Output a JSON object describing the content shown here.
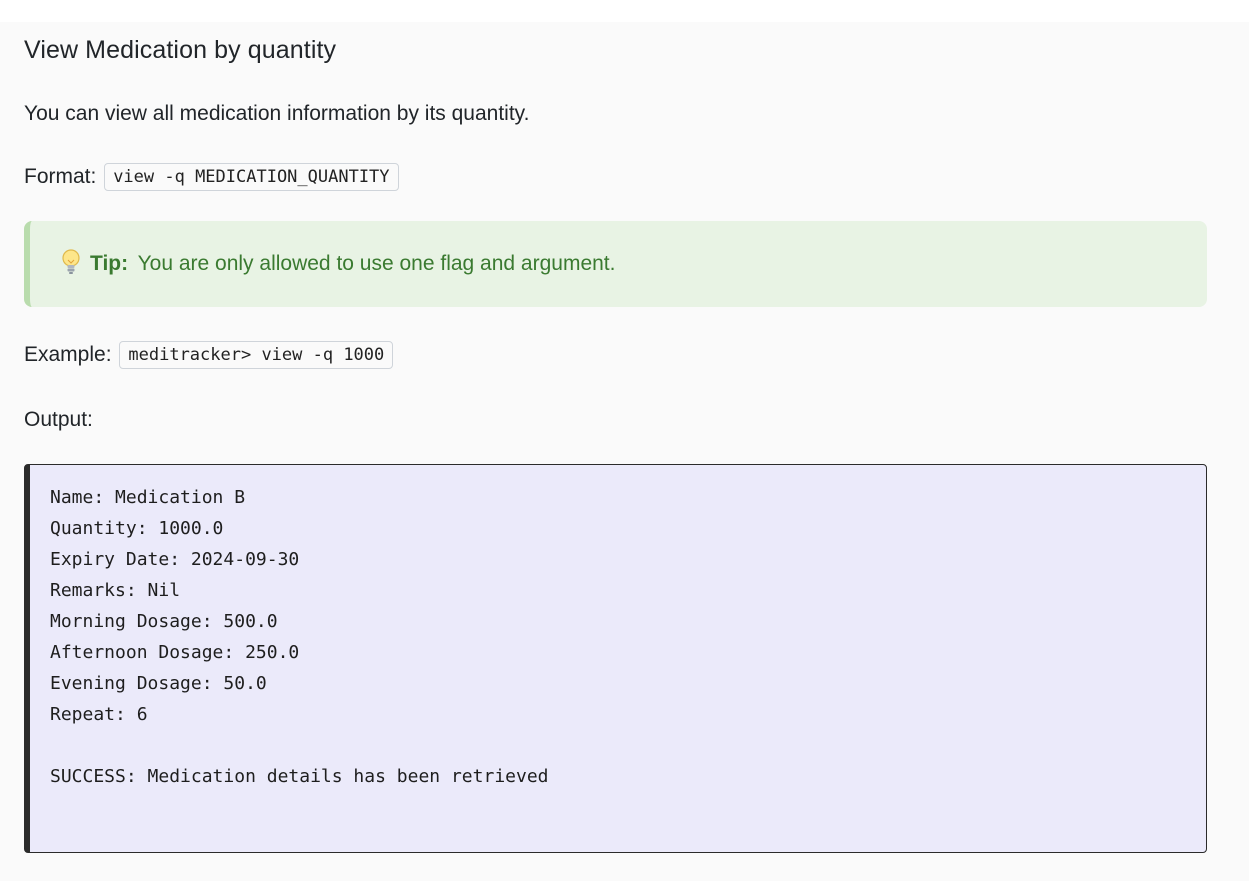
{
  "section": {
    "title": "View Medication by quantity",
    "description": "You can view all medication information by its quantity."
  },
  "format": {
    "label": "Format:",
    "command": "view -q MEDICATION_QUANTITY"
  },
  "tip": {
    "icon": "lightbulb-icon",
    "label": "Tip:",
    "text": "You are only allowed to use one flag and argument."
  },
  "example": {
    "label": "Example:",
    "command": "meditracker> view -q 1000"
  },
  "output": {
    "label": "Output:",
    "lines": [
      "Name: Medication B",
      "Quantity: 1000.0",
      "Expiry Date: 2024-09-30",
      "Remarks: Nil",
      "Morning Dosage: 500.0",
      "Afternoon Dosage: 250.0",
      "Evening Dosage: 50.0",
      "Repeat: 6",
      "",
      "SUCCESS: Medication details has been retrieved"
    ]
  },
  "colors": {
    "page_background": "#fafafa",
    "tip_background": "#e8f3e4",
    "tip_border": "#b9dcad",
    "tip_text": "#3a7a30",
    "code_background": "#ebeafa",
    "code_border": "#2b2b2b"
  }
}
